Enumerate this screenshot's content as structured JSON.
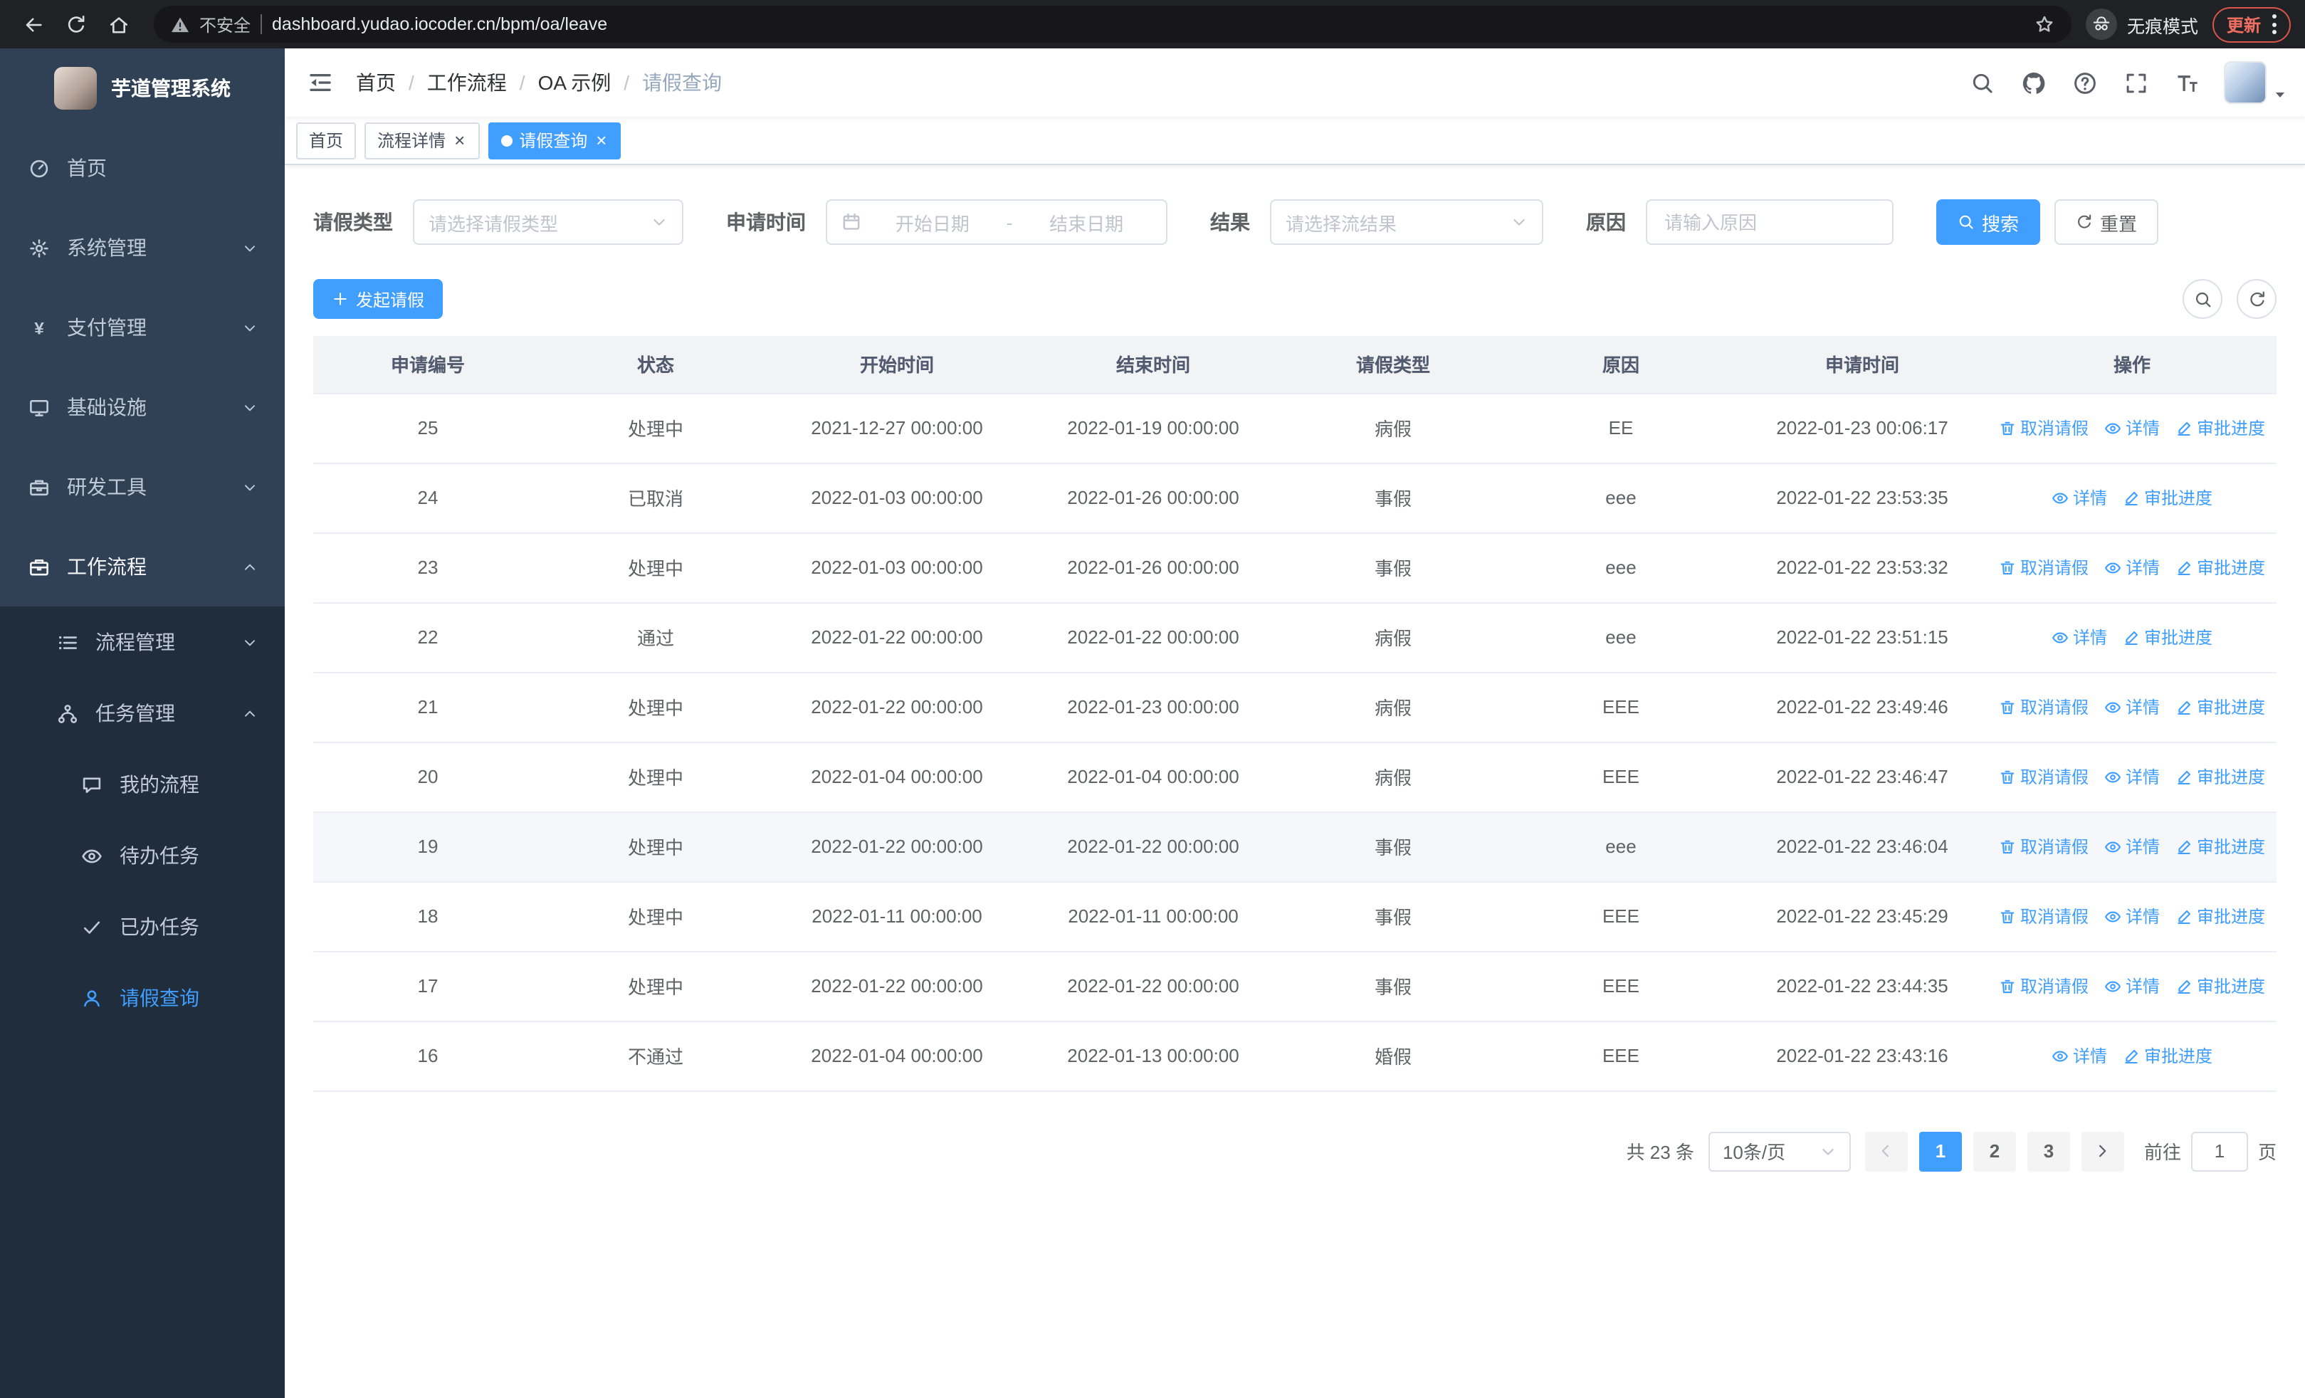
{
  "browser": {
    "security_label": "不安全",
    "url": "dashboard.yudao.iocoder.cn/bpm/oa/leave",
    "incognito_label": "无痕模式",
    "update_label": "更新"
  },
  "sidebar": {
    "logo_title": "芋道管理系统",
    "menu": [
      {
        "key": "home",
        "icon": "dashboard",
        "label": "首页"
      },
      {
        "key": "system",
        "icon": "gear",
        "label": "系统管理",
        "arrow": "down"
      },
      {
        "key": "payment",
        "icon": "yen",
        "label": "支付管理",
        "arrow": "down"
      },
      {
        "key": "infra",
        "icon": "monitor",
        "label": "基础设施",
        "arrow": "down"
      },
      {
        "key": "devtools",
        "icon": "toolbox",
        "label": "研发工具",
        "arrow": "down"
      },
      {
        "key": "workflow",
        "icon": "briefcase",
        "label": "工作流程",
        "arrow": "up",
        "highlight": true,
        "children": [
          {
            "key": "process-mgmt",
            "icon": "list",
            "label": "流程管理",
            "arrow": "down"
          },
          {
            "key": "task-mgmt",
            "icon": "flow",
            "label": "任务管理",
            "arrow": "up",
            "children": [
              {
                "key": "my-process",
                "icon": "comment",
                "label": "我的流程"
              },
              {
                "key": "todo-tasks",
                "icon": "eye",
                "label": "待办任务"
              },
              {
                "key": "done-tasks",
                "icon": "check",
                "label": "已办任务"
              },
              {
                "key": "leave-query",
                "icon": "user",
                "label": "请假查询",
                "active": true
              }
            ]
          }
        ]
      }
    ]
  },
  "header": {
    "separator": "/",
    "breadcrumb": [
      "首页",
      "工作流程",
      "OA 示例",
      "请假查询"
    ]
  },
  "tabs": [
    {
      "key": "home",
      "label": "首页"
    },
    {
      "key": "process-detail",
      "label": "流程详情",
      "closable": true
    },
    {
      "key": "leave-query",
      "label": "请假查询",
      "closable": true,
      "active": true
    }
  ],
  "filters": {
    "leave_type_label": "请假类型",
    "leave_type_placeholder": "请选择请假类型",
    "apply_time_label": "申请时间",
    "start_date_placeholder": "开始日期",
    "range_separator": "-",
    "end_date_placeholder": "结束日期",
    "result_label": "结果",
    "result_placeholder": "请选择流结果",
    "reason_label": "原因",
    "reason_placeholder": "请输入原因",
    "search_button": "搜索",
    "reset_button": "重置"
  },
  "toolbar": {
    "create_button": "发起请假"
  },
  "table": {
    "headers": [
      "申请编号",
      "状态",
      "开始时间",
      "结束时间",
      "请假类型",
      "原因",
      "申请时间",
      "操作"
    ],
    "actions": {
      "cancel": "取消请假",
      "detail": "详情",
      "progress": "审批进度"
    },
    "rows": [
      {
        "id": "25",
        "status": "处理中",
        "start": "2021-12-27 00:00:00",
        "end": "2022-01-19 00:00:00",
        "type": "病假",
        "reason": "EE",
        "applied": "2022-01-23 00:06:17",
        "can_cancel": true,
        "hovered": false
      },
      {
        "id": "24",
        "status": "已取消",
        "start": "2022-01-03 00:00:00",
        "end": "2022-01-26 00:00:00",
        "type": "事假",
        "reason": "eee",
        "applied": "2022-01-22 23:53:35",
        "can_cancel": false,
        "hovered": false
      },
      {
        "id": "23",
        "status": "处理中",
        "start": "2022-01-03 00:00:00",
        "end": "2022-01-26 00:00:00",
        "type": "事假",
        "reason": "eee",
        "applied": "2022-01-22 23:53:32",
        "can_cancel": true,
        "hovered": false
      },
      {
        "id": "22",
        "status": "通过",
        "start": "2022-01-22 00:00:00",
        "end": "2022-01-22 00:00:00",
        "type": "病假",
        "reason": "eee",
        "applied": "2022-01-22 23:51:15",
        "can_cancel": false,
        "hovered": false
      },
      {
        "id": "21",
        "status": "处理中",
        "start": "2022-01-22 00:00:00",
        "end": "2022-01-23 00:00:00",
        "type": "病假",
        "reason": "EEE",
        "applied": "2022-01-22 23:49:46",
        "can_cancel": true,
        "hovered": false
      },
      {
        "id": "20",
        "status": "处理中",
        "start": "2022-01-04 00:00:00",
        "end": "2022-01-04 00:00:00",
        "type": "病假",
        "reason": "EEE",
        "applied": "2022-01-22 23:46:47",
        "can_cancel": true,
        "hovered": false
      },
      {
        "id": "19",
        "status": "处理中",
        "start": "2022-01-22 00:00:00",
        "end": "2022-01-22 00:00:00",
        "type": "事假",
        "reason": "eee",
        "applied": "2022-01-22 23:46:04",
        "can_cancel": true,
        "hovered": true
      },
      {
        "id": "18",
        "status": "处理中",
        "start": "2022-01-11 00:00:00",
        "end": "2022-01-11 00:00:00",
        "type": "事假",
        "reason": "EEE",
        "applied": "2022-01-22 23:45:29",
        "can_cancel": true,
        "hovered": false
      },
      {
        "id": "17",
        "status": "处理中",
        "start": "2022-01-22 00:00:00",
        "end": "2022-01-22 00:00:00",
        "type": "事假",
        "reason": "EEE",
        "applied": "2022-01-22 23:44:35",
        "can_cancel": true,
        "hovered": false
      },
      {
        "id": "16",
        "status": "不通过",
        "start": "2022-01-04 00:00:00",
        "end": "2022-01-13 00:00:00",
        "type": "婚假",
        "reason": "EEE",
        "applied": "2022-01-22 23:43:16",
        "can_cancel": false,
        "hovered": false
      }
    ]
  },
  "pagination": {
    "total_label": "共 23 条",
    "page_size": "10条/页",
    "pages": [
      "1",
      "2",
      "3"
    ],
    "active_page": "1",
    "goto_prefix": "前往",
    "goto_value": "1",
    "goto_suffix": "页"
  },
  "colors": {
    "primary": "#409eff",
    "sidebar_bg": "#304156",
    "submenu_bg": "#1f2d3d",
    "chrome_bg": "#202124",
    "update_red": "#d9554a"
  }
}
